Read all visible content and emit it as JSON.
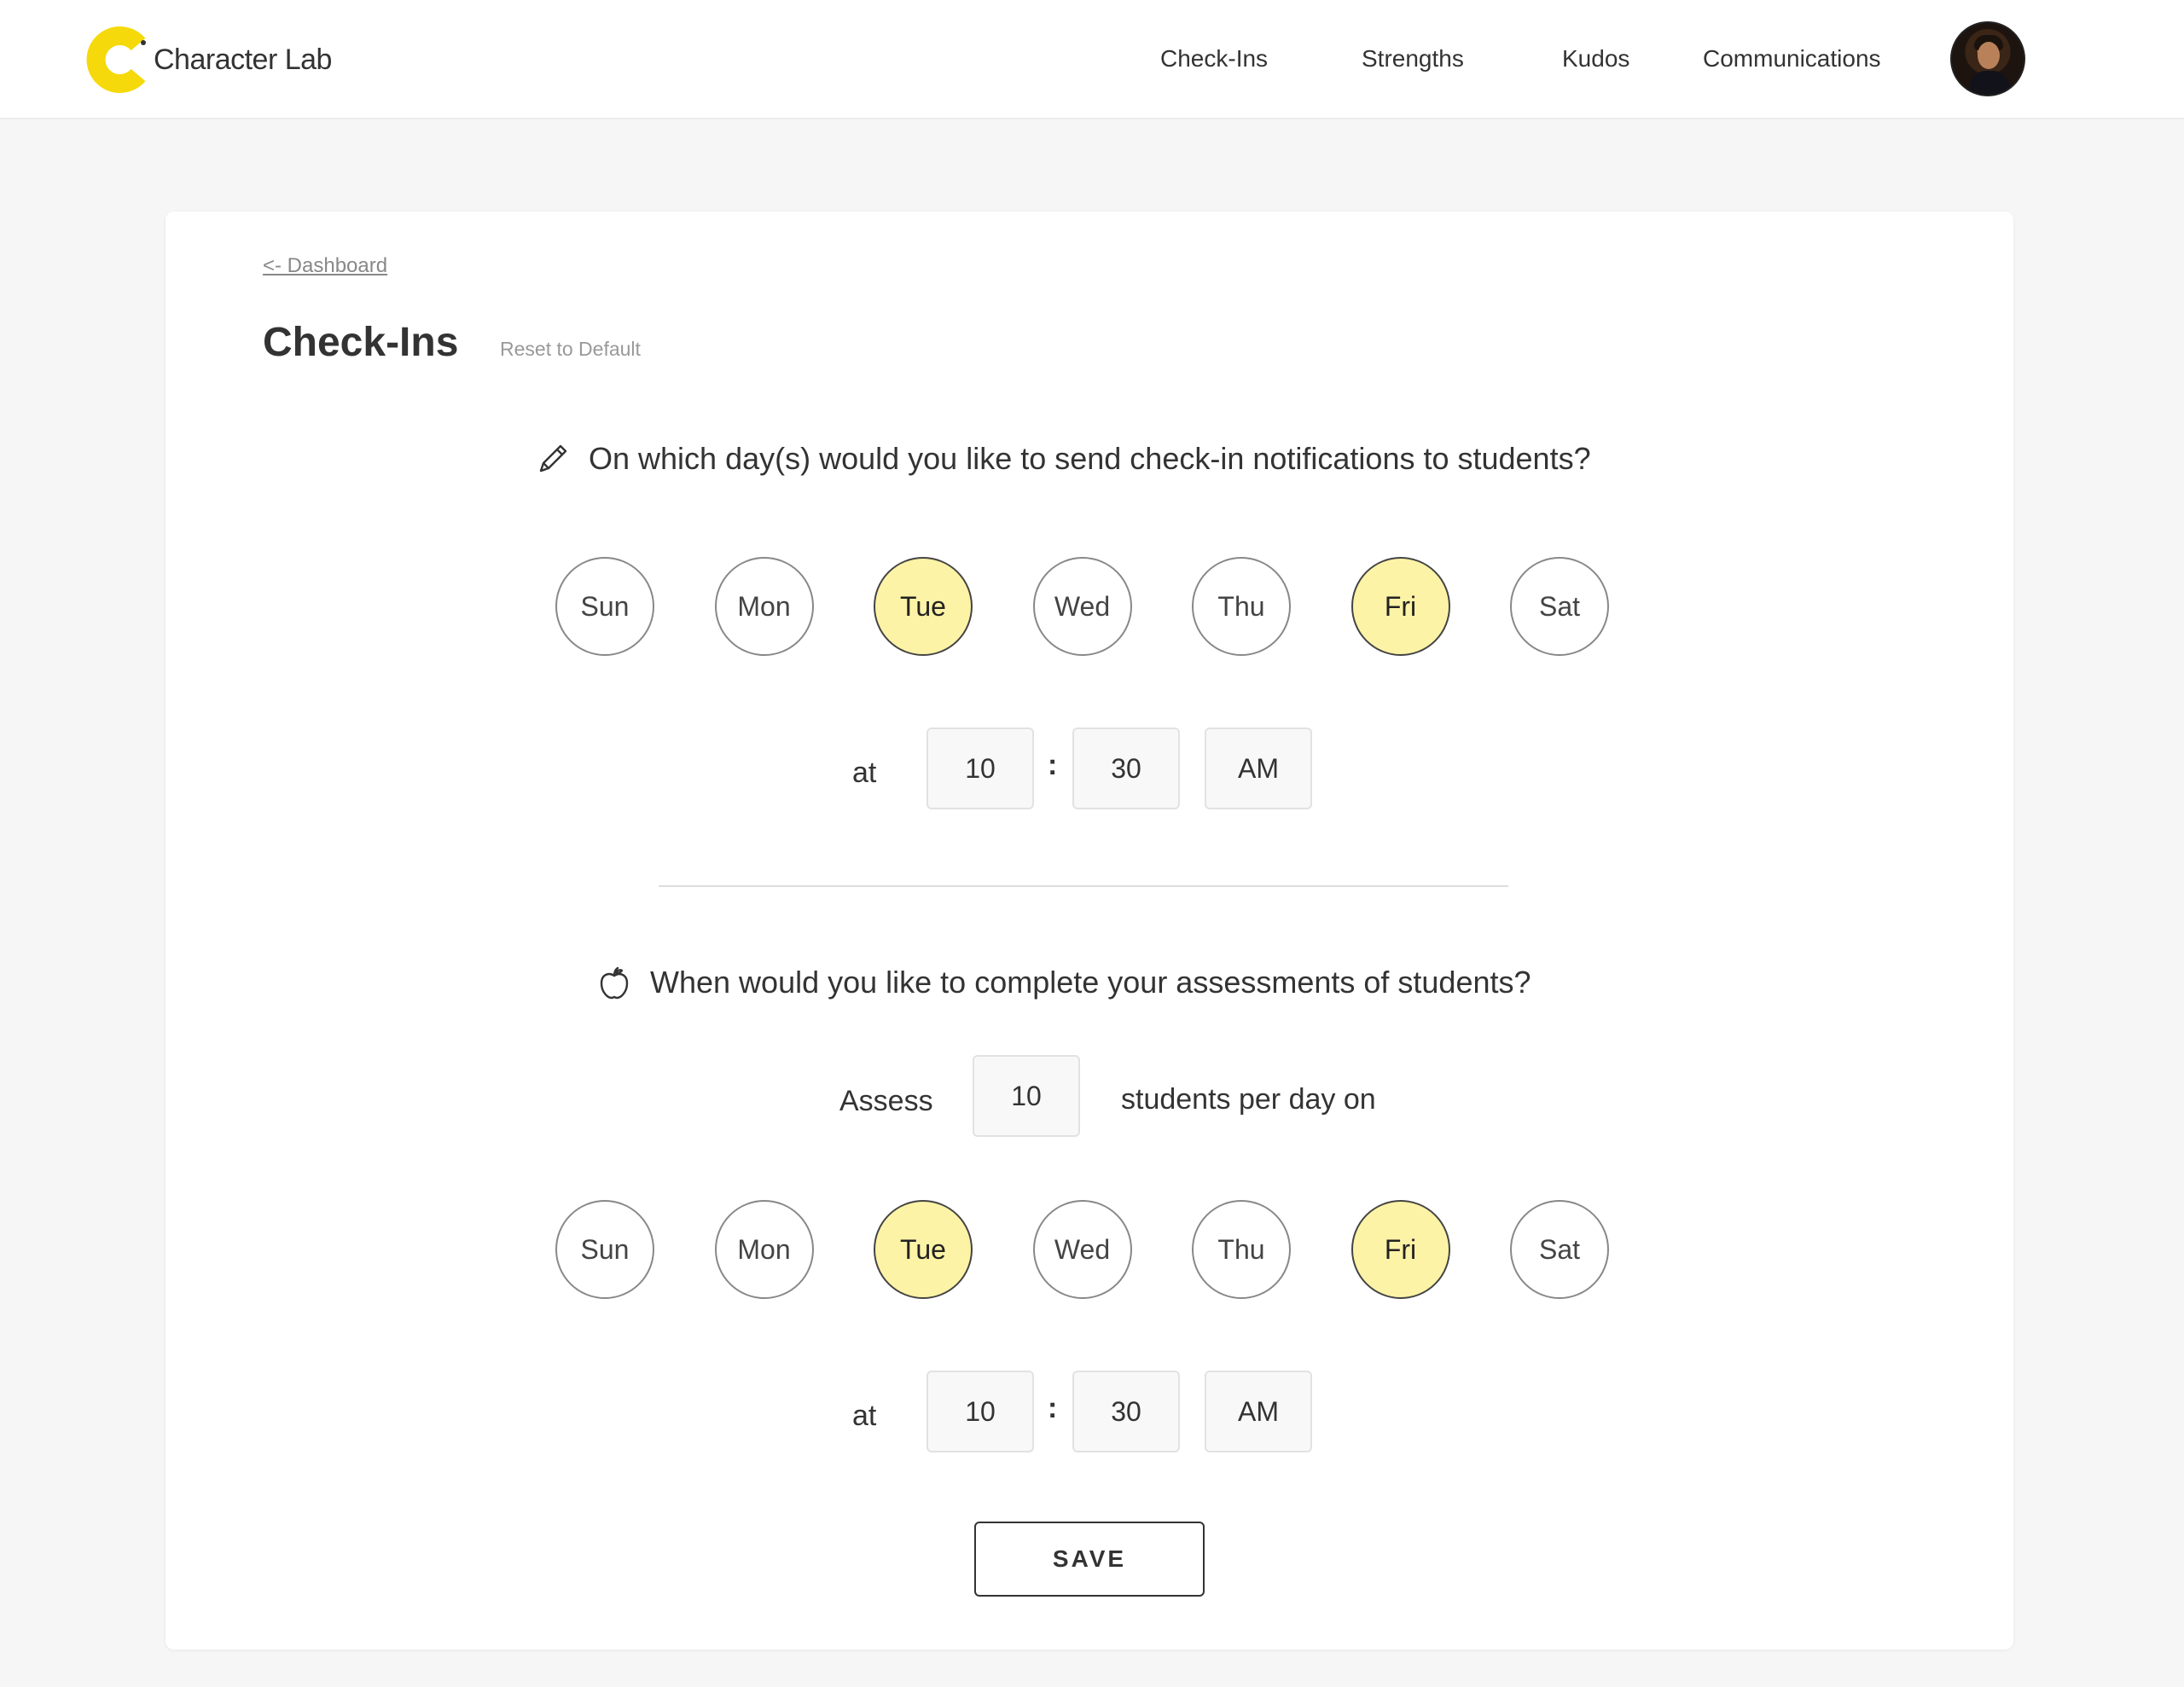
{
  "header": {
    "logo_text": "Character Lab",
    "nav": [
      "Check-Ins",
      "Strengths",
      "Kudos",
      "Communications"
    ]
  },
  "page": {
    "back_link": "<- Dashboard",
    "title": "Check-Ins",
    "reset": "Reset to Default"
  },
  "notifications": {
    "question": "On which day(s) would you like to send check-in notifications to students?",
    "days": [
      {
        "label": "Sun",
        "selected": false
      },
      {
        "label": "Mon",
        "selected": false
      },
      {
        "label": "Tue",
        "selected": true
      },
      {
        "label": "Wed",
        "selected": false
      },
      {
        "label": "Thu",
        "selected": false
      },
      {
        "label": "Fri",
        "selected": true
      },
      {
        "label": "Sat",
        "selected": false
      }
    ],
    "at_label": "at",
    "hour": "10",
    "minute": "30",
    "ampm": "AM"
  },
  "assessments": {
    "question": "When would you like to complete your assessments of students?",
    "assess_label": "Assess",
    "count": "10",
    "per_day_label": "students per day on",
    "days": [
      {
        "label": "Sun",
        "selected": false
      },
      {
        "label": "Mon",
        "selected": false
      },
      {
        "label": "Tue",
        "selected": true
      },
      {
        "label": "Wed",
        "selected": false
      },
      {
        "label": "Thu",
        "selected": false
      },
      {
        "label": "Fri",
        "selected": true
      },
      {
        "label": "Sat",
        "selected": false
      }
    ],
    "at_label": "at",
    "hour": "10",
    "minute": "30",
    "ampm": "AM"
  },
  "save_label": "SAVE",
  "colors": {
    "accent": "#fdf3a6",
    "logo": "#f5d90a"
  },
  "icons": {
    "logo": "character-lab-logo-icon",
    "pencil": "pencil-icon",
    "apple": "apple-icon"
  }
}
